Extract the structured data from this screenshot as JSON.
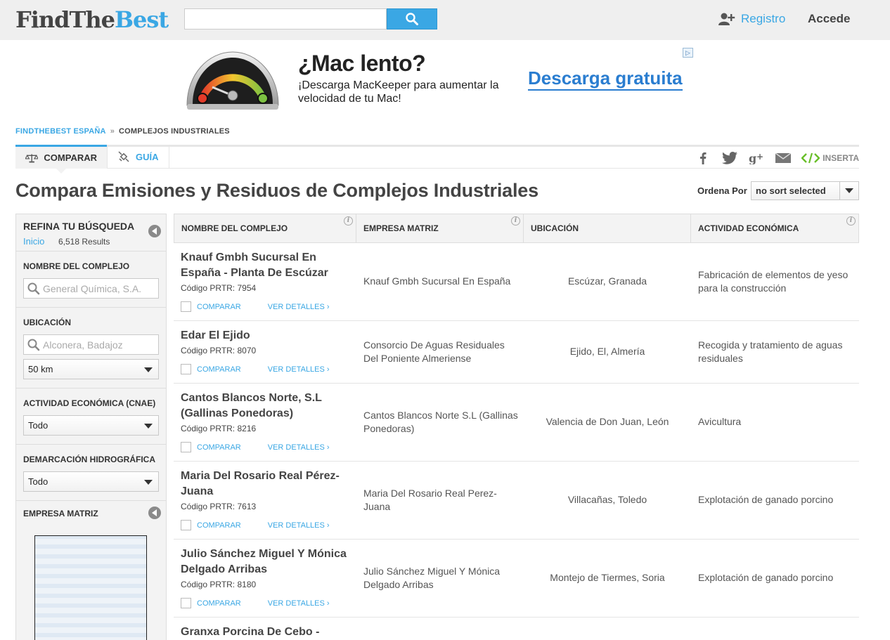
{
  "header": {
    "logo_dark": "FindThe",
    "logo_blue": "Best",
    "search_value": "",
    "register": "Registro",
    "login": "Accede"
  },
  "ad": {
    "title": "¿Mac lento?",
    "subtitle": "¡Descarga MacKeeper para aumentar la velocidad de tu Mac!",
    "cta": "Descarga gratuita"
  },
  "breadcrumb": {
    "home": "FINDTHEBEST ESPAÑA",
    "separator": "»",
    "current": "COMPLEJOS INDUSTRIALES"
  },
  "tabs": {
    "compare": "COMPARAR",
    "guide": "GUÍA",
    "embed": "INSERTA"
  },
  "page": {
    "title": "Compara Emisiones y Residuos de Complejos Industriales",
    "sort_label": "Ordena Por",
    "sort_value": "no sort selected"
  },
  "sidebar": {
    "title": "REFINA TU BÚSQUEDA",
    "home": "Inicio",
    "count": "6,518 Results",
    "filters": {
      "name": {
        "label": "NOMBRE DEL COMPLEJO",
        "placeholder": "General Química, S.A."
      },
      "location": {
        "label": "UBICACIÓN",
        "placeholder": "Alconera, Badajoz",
        "radius": "50 km"
      },
      "activity": {
        "label": "ACTIVIDAD ECONÓMICA (CNAE)",
        "value": "Todo"
      },
      "basin": {
        "label": "DEMARCACIÓN HIDROGRÁFICA",
        "value": "Todo"
      },
      "parent": {
        "label": "EMPRESA MATRIZ"
      }
    }
  },
  "table": {
    "columns": [
      "NOMBRE DEL COMPLEJO",
      "EMPRESA MATRIZ",
      "UBICACIÓN",
      "ACTIVIDAD ECONÓMICA"
    ],
    "code_label": "Código PRTR:",
    "compare_label": "COMPARAR",
    "details_label": "VER DETALLES ›",
    "rows": [
      {
        "name": "Knauf Gmbh Sucursal En España - Planta De Escúzar",
        "code": "7954",
        "parent": "Knauf Gmbh Sucursal En España",
        "location": "Escúzar, Granada",
        "activity": "Fabricación de elementos de yeso para la construcción"
      },
      {
        "name": "Edar El Ejido",
        "code": "8070",
        "parent": "Consorcio De Aguas Residuales Del Poniente Almeriense",
        "location": "Ejido, El, Almería",
        "activity": "Recogida y tratamiento de aguas residuales"
      },
      {
        "name": "Cantos Blancos Norte, S.L (Gallinas Ponedoras)",
        "code": "8216",
        "parent": "Cantos Blancos Norte S.L (Gallinas Ponedoras)",
        "location": "Valencia de Don Juan, León",
        "activity": "Avicultura"
      },
      {
        "name": "Maria Del Rosario Real Pérez-Juana",
        "code": "7613",
        "parent": "Maria Del Rosario Real Perez-Juana",
        "location": "Villacañas, Toledo",
        "activity": "Explotación de ganado porcino"
      },
      {
        "name": "Julio Sánchez Miguel Y Mónica Delgado Arribas",
        "code": "8180",
        "parent": "Julio Sánchez Miguel Y Mónica Delgado Arribas",
        "location": "Montejo de Tiermes, Soria",
        "activity": "Explotación de ganado porcino"
      },
      {
        "name": "Granxa Porcina De Cebo -",
        "code": "",
        "parent": "",
        "location": "",
        "activity": ""
      }
    ]
  },
  "colors": {
    "brand_blue": "#3aa7e4",
    "text_dark": "#444444",
    "header_bg": "#efefef"
  }
}
